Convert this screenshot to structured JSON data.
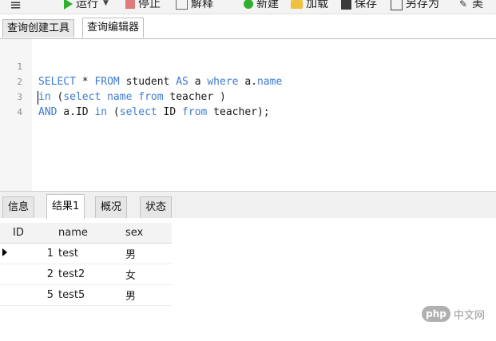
{
  "toolbar": {
    "menu_icon": "≡",
    "run_label": "运行",
    "stop_label": "停止",
    "explain_label": "解释",
    "new_label": "新建",
    "load_label": "加载",
    "save_label": "保存",
    "save_as_label": "另存为",
    "beautify_label": "美"
  },
  "editor_tabs": [
    "查询创建工具",
    "查询编辑器"
  ],
  "editor": {
    "lines": [
      {
        "no": "1"
      },
      {
        "no": "2"
      },
      {
        "no": "3"
      },
      {
        "no": "4"
      }
    ],
    "tokens": {
      "l1": [
        "SELECT",
        " * ",
        "FROM",
        " student ",
        "AS",
        " a ",
        "where",
        " a.",
        "name"
      ],
      "l2": [
        "in",
        " (",
        "select",
        " ",
        "name",
        " ",
        "from",
        " teacher )"
      ],
      "l3": [
        "AND",
        " a.ID ",
        "in",
        " (",
        "select",
        " ID ",
        "from",
        " teacher);"
      ]
    }
  },
  "result_tabs": [
    "信息",
    "结果1",
    "概况",
    "状态"
  ],
  "grid": {
    "columns": [
      "ID",
      "name",
      "sex"
    ],
    "rows": [
      {
        "id": "1",
        "name": "test",
        "sex": "男"
      },
      {
        "id": "2",
        "name": "test2",
        "sex": "女"
      },
      {
        "id": "5",
        "name": "test5",
        "sex": "男"
      }
    ]
  },
  "watermark": {
    "logo": "php",
    "text": "中文网"
  },
  "colors": {
    "keyword": "#3d7ccf",
    "run_icon": "#2fb12f"
  }
}
